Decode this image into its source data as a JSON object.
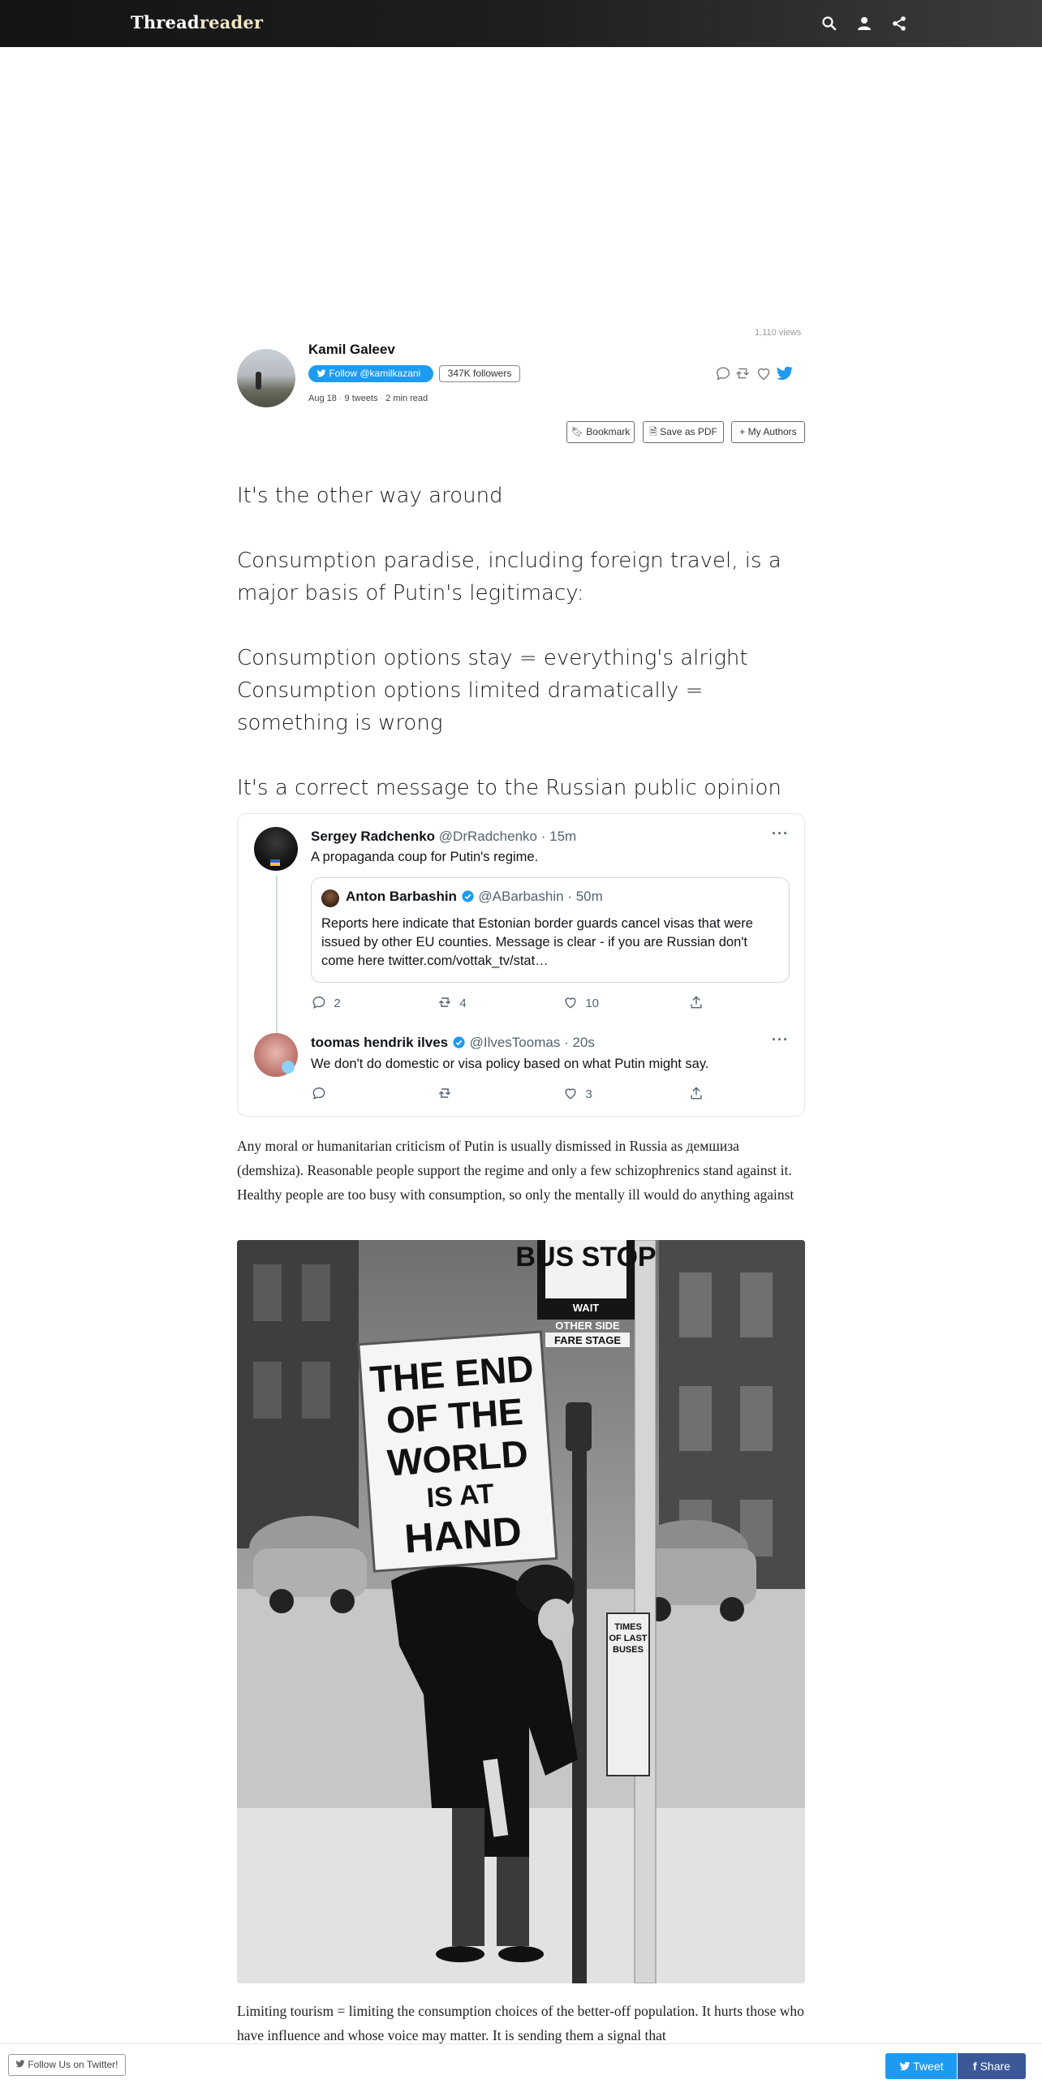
{
  "navbar": {
    "brand_part1": "Thread",
    "brand_part2": "reader"
  },
  "author": {
    "views": "1,110 views",
    "name": "Kamil Galeev",
    "follow_label": "Follow @kamilkazani",
    "followers": "347K followers",
    "date": "Aug 18",
    "tweets": "9 tweets",
    "read_time": "2 min read"
  },
  "actions": {
    "bookmark": "Bookmark",
    "save_pdf": "Save as PDF",
    "my_authors": "My Authors"
  },
  "thread": {
    "p1": "It's the other way around",
    "p2": "Consumption paradise, including foreign travel, is a major basis of Putin's legitimacy:",
    "p3a": "Consumption options stay = everything's alright",
    "p3b": "Consumption options limited dramatically = something is wrong",
    "p4": "It's a correct message to the Russian public opinion",
    "p5": "Any moral or humanitarian criticism of Putin is usually dismissed in Russia as демшиза (demshiza). Reasonable people support the regime and only a few schizophrenics stand against it. Healthy people are too busy with consumption, so only the mentally ill would do anything against",
    "p6": "Limiting tourism = limiting the consumption choices of the better-off population. It hurts those who have influence and whose voice may matter. It is sending them a signal that"
  },
  "embed": {
    "tweet1": {
      "name": "Sergey Radchenko",
      "handle": "@DrRadchenko",
      "time": "· 15m",
      "text": "A propaganda coup for Putin's regime.",
      "replies": "2",
      "retweets": "4",
      "likes": "10"
    },
    "quote": {
      "name": "Anton Barbashin",
      "handle": "@ABarbashin",
      "time": "· 50m",
      "text": "Reports here indicate that Estonian border guards cancel visas that were issued by other EU counties. Message is clear - if you are Russian don't come here twitter.com/vottak_tv/stat…"
    },
    "tweet2": {
      "name": "toomas hendrik ilves",
      "handle": "@IlvesToomas",
      "time": "· 20s",
      "text": "We don't do domestic or visa policy based on what Putin might say.",
      "likes": "3"
    },
    "more": "···"
  },
  "photo": {
    "bus_stop": "BUS STOP",
    "wait": "WAIT",
    "other_side": "OTHER SIDE",
    "fare_stage": "FARE STAGE",
    "sign_line1": "THE END",
    "sign_line2": "OF THE",
    "sign_line3": "WORLD",
    "sign_line4": "IS AT",
    "sign_line5": "HAND",
    "times1": "TIMES",
    "times2": "OF LAST",
    "times3": "BUSES"
  },
  "bottombar": {
    "follow_us": "Follow Us on Twitter!",
    "tweet": "Tweet",
    "share": "Share"
  }
}
